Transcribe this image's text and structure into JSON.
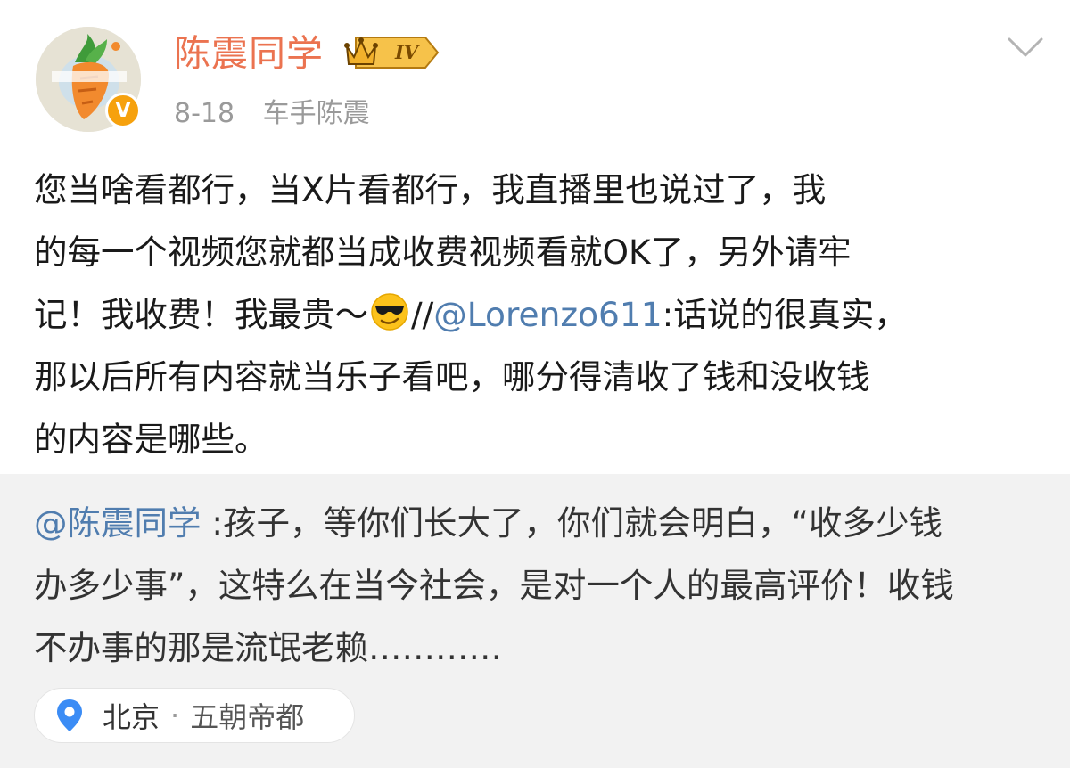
{
  "post": {
    "author": "陈震同学",
    "rank_level": "IV",
    "date": "8-18",
    "source": "车手陈震",
    "icons": {
      "avatar": "carrot-avatar",
      "verified": "verified-v-badge",
      "rank": "crown-rank-badge",
      "menu": "chevron-down-icon",
      "emoji": "cool-sunglasses-emoji"
    },
    "verified_letter": "V",
    "body": {
      "line1": "您当啥看都行，当X片看都行，我直播里也说过了，我",
      "line2": "的每一个视频您就都当成收费视频看就OK了，另外请牢",
      "line3_text": "记！我收费！我最贵～",
      "line3_slashes": "//",
      "line3_mention": "@Lorenzo611",
      "line3_tail": ":话说的很真实，",
      "line4": "那以后所有内容就当乐子看吧，哪分得清收了钱和没收钱",
      "line5": "的内容是哪些。"
    }
  },
  "retweet": {
    "mention": "@陈震同学",
    "line1_tail": " :孩子，等你们长大了，你们就会明白，“收多少钱",
    "line2": "办多少事”，这特么在当今社会，是对一个人的最高评价！收钱",
    "line3": "不办事的那是流氓老赖…………"
  },
  "location": {
    "icon": "location-pin-icon",
    "city": "北京",
    "separator": "·",
    "detail": "五朝帝都"
  },
  "colors": {
    "username": "#eb7350",
    "mention": "#507daf",
    "meta": "#9a9a9a",
    "retweet_bg": "#f2f2f2",
    "verified": "#f6a10d",
    "pin": "#3b8cf5"
  }
}
